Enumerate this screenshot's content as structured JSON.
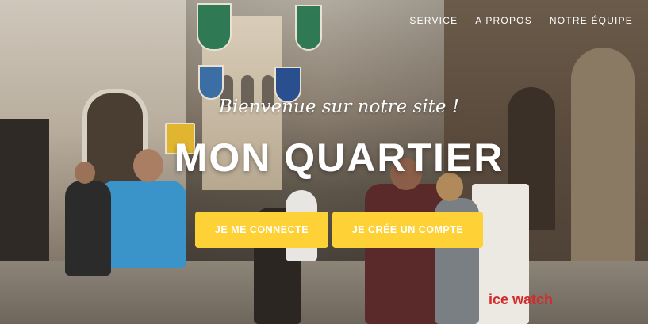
{
  "nav": {
    "items": [
      "SERVICE",
      "A PROPOS",
      "NOTRE ÉQUIPE"
    ]
  },
  "hero": {
    "tagline": "Bienvenue sur notre site !",
    "title": "MON QUARTIER",
    "login_button": "JE ME CONNECTE",
    "signup_button": "JE CRÉE UN COMPTE",
    "background_sign_text": "ice watch"
  },
  "colors": {
    "accent": "#fed136",
    "text": "#ffffff"
  }
}
